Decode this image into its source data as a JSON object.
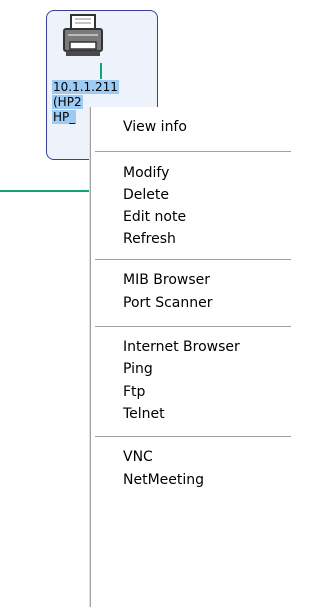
{
  "node": {
    "icon": "printer-icon",
    "ip_line": "10.1.1.211",
    "line2": "(HP2",
    "line3": "HP_"
  },
  "menu": {
    "items": [
      {
        "label": "View info"
      },
      {
        "label": "Modify"
      },
      {
        "label": "Delete"
      },
      {
        "label": "Edit note"
      },
      {
        "label": "Refresh"
      },
      {
        "label": "MIB Browser"
      },
      {
        "label": "Port Scanner"
      },
      {
        "label": "Internet Browser"
      },
      {
        "label": "Ping"
      },
      {
        "label": "Ftp"
      },
      {
        "label": "Telnet"
      },
      {
        "label": "VNC"
      },
      {
        "label": "NetMeeting"
      }
    ]
  },
  "colors": {
    "selection": "#9ecbf3",
    "link": "#12a574",
    "node_border": "#3a3f9a"
  }
}
